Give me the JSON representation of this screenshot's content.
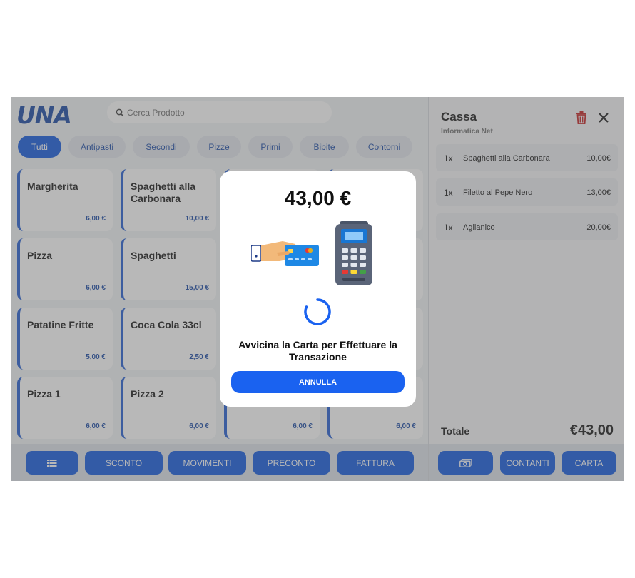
{
  "header": {
    "logo": "UNA",
    "search": {
      "placeholder": "Cerca Prodotto"
    }
  },
  "categories": [
    {
      "label": "Tutti",
      "active": true
    },
    {
      "label": "Antipasti"
    },
    {
      "label": "Secondi"
    },
    {
      "label": "Pizze"
    },
    {
      "label": "Primi"
    },
    {
      "label": "Bibite"
    },
    {
      "label": "Contorni"
    }
  ],
  "products": [
    {
      "name": "Margherita",
      "price": "6,00 €"
    },
    {
      "name": "Spaghetti alla Carbonara",
      "price": "10,00 €"
    },
    {
      "name": "",
      "price": ""
    },
    {
      "name": "",
      "price": ""
    },
    {
      "name": "Pizza",
      "price": "6,00 €"
    },
    {
      "name": "Spaghetti",
      "price": "15,00 €"
    },
    {
      "name": "",
      "price": ""
    },
    {
      "name": "",
      "price": ""
    },
    {
      "name": "Patatine Fritte",
      "price": "5,00 €"
    },
    {
      "name": "Coca Cola 33cl",
      "price": "2,50 €"
    },
    {
      "name": "",
      "price": ""
    },
    {
      "name": "",
      "price": ""
    },
    {
      "name": "Pizza 1",
      "price": "6,00 €"
    },
    {
      "name": "Pizza 2",
      "price": "6,00 €"
    },
    {
      "name": "",
      "price": "6,00 €"
    },
    {
      "name": "",
      "price": "6,00 €"
    }
  ],
  "bottom_bar": {
    "list_icon": "list-icon",
    "sconto": "SCONTO",
    "movimenti": "MOVIMENTI",
    "preconto": "PRECONTO",
    "fattura": "FATTURA"
  },
  "cart": {
    "title": "Cassa",
    "subtitle": "Informatica Net",
    "items": [
      {
        "qty": "1x",
        "name": "Spaghetti alla Carbonara",
        "amount": "10,00€"
      },
      {
        "qty": "1x",
        "name": "Filetto al Pepe Nero",
        "amount": "13,00€"
      },
      {
        "qty": "1x",
        "name": "Aglianico",
        "amount": "20,00€"
      }
    ],
    "total_label": "Totale",
    "total_value": "€43,00",
    "contanti": "CONTANTI",
    "carta": "CARTA"
  },
  "modal": {
    "amount": "43,00 €",
    "message": "Avvicina la Carta per Effettuare la Transazione",
    "cancel": "ANNULLA"
  },
  "colors": {
    "accent": "#1a5fe0",
    "brand": "#1f4ea8",
    "danger": "#c62828"
  }
}
